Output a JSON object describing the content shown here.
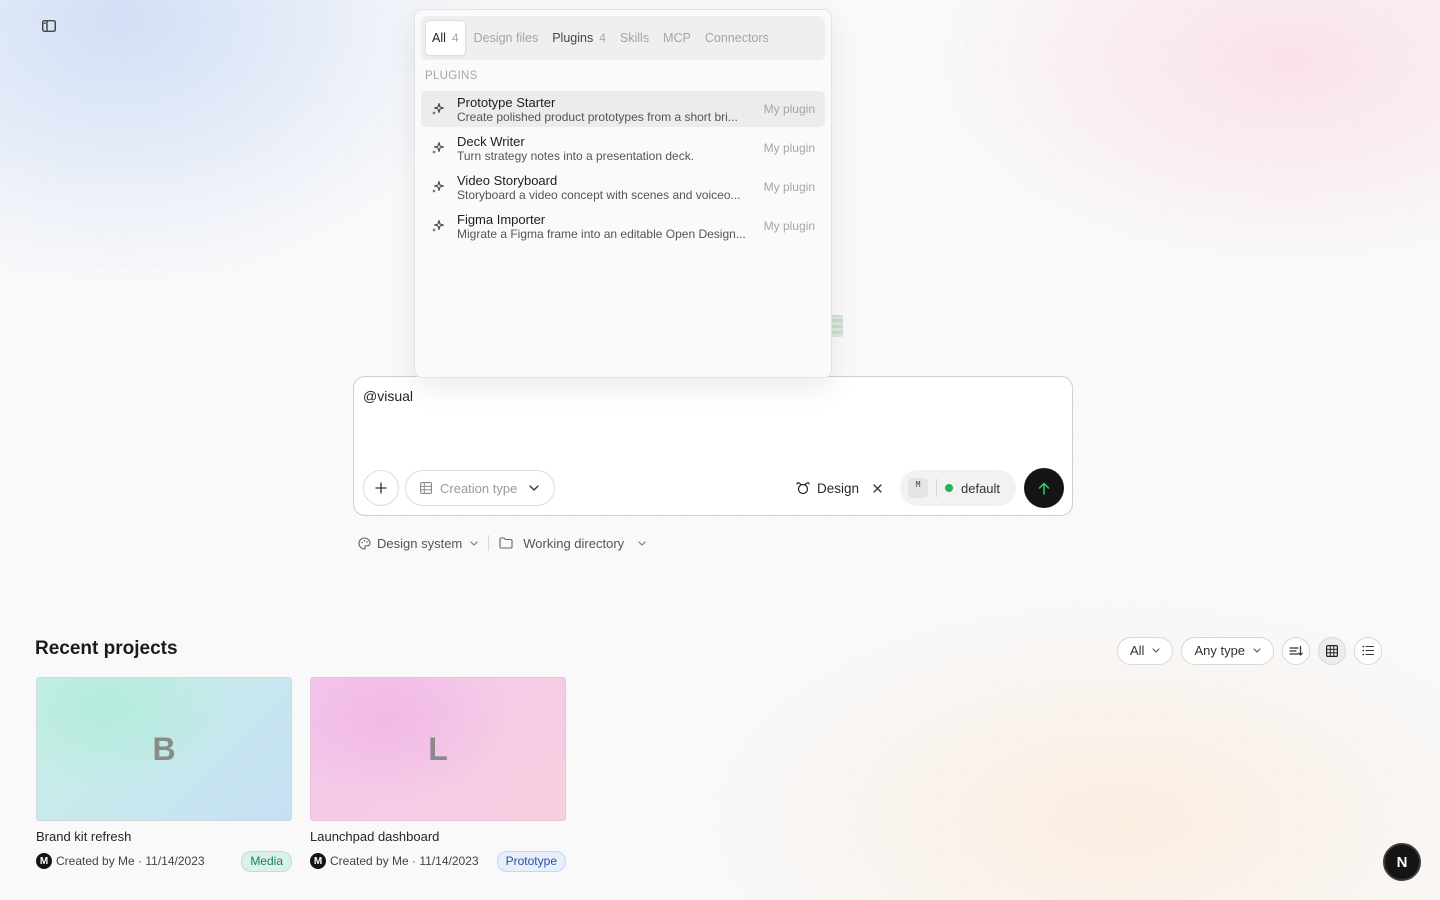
{
  "popup": {
    "tabs": [
      {
        "label": "All",
        "count": "4"
      },
      {
        "label": "Design files",
        "count": ""
      },
      {
        "label": "Plugins",
        "count": "4"
      },
      {
        "label": "Skills",
        "count": ""
      },
      {
        "label": "MCP",
        "count": ""
      },
      {
        "label": "Connectors",
        "count": ""
      }
    ],
    "section_label": "PLUGINS",
    "plugins": [
      {
        "name": "Prototype Starter",
        "desc": "Create polished product prototypes from a short bri...",
        "tag": "My plugin"
      },
      {
        "name": "Deck Writer",
        "desc": "Turn strategy notes into a presentation deck.",
        "tag": "My plugin"
      },
      {
        "name": "Video Storyboard",
        "desc": "Storyboard a video concept with scenes and voiceo...",
        "tag": "My plugin"
      },
      {
        "name": "Figma Importer",
        "desc": "Migrate a Figma frame into an editable Open Design...",
        "tag": "My plugin"
      }
    ]
  },
  "composer": {
    "text": "@visual",
    "creation_type_label": "Creation type",
    "design_chip_label": "Design",
    "model_badge": "M",
    "model_label": "default"
  },
  "sub_row": {
    "design_system_label": "Design system",
    "working_directory_label": "Working directory"
  },
  "recent": {
    "title": "Recent projects",
    "filter_all": "All",
    "filter_type": "Any type",
    "projects": [
      {
        "letter": "B",
        "title": "Brand kit refresh",
        "avatar": "M",
        "meta": "Created by Me · 11/14/2023",
        "badge": "Media"
      },
      {
        "letter": "L",
        "title": "Launchpad dashboard",
        "avatar": "M",
        "meta": "Created by Me · 11/14/2023",
        "badge": "Prototype"
      }
    ]
  },
  "fab_label": "N",
  "colors": {
    "accent_dark": "#151515",
    "status_green": "#22b05a",
    "media_badge": "#d9f1ea",
    "prototype_badge": "#e7eefc"
  }
}
